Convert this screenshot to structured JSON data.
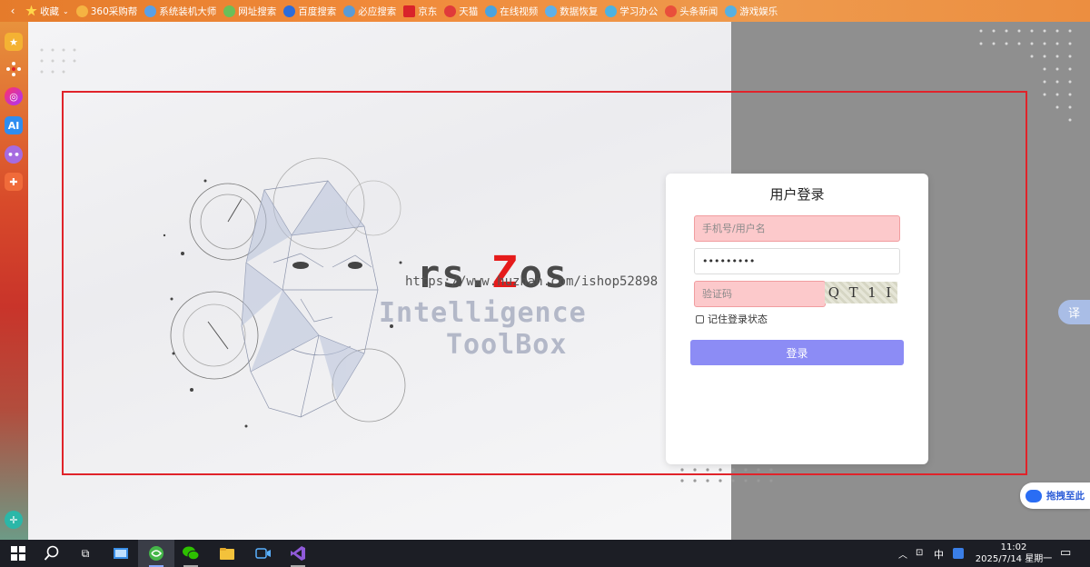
{
  "bookmarks": {
    "favorites": "收藏",
    "items": [
      "360采购帮",
      "系统装机大师",
      "网址搜索",
      "百度搜索",
      "必应搜索",
      "京东",
      "天猫",
      "在线视频",
      "数据恢复",
      "学习办公",
      "头条新闻",
      "游戏娱乐"
    ],
    "colors": [
      "#f5b342",
      "#5aa0e6",
      "#6bbf59",
      "#2c6cd8",
      "#5b9bd5",
      "#d9232a",
      "#e03a3a",
      "#4aa3df",
      "#5fb0e8",
      "#4db2e0",
      "#e94f3b",
      "#57b0e0"
    ]
  },
  "sidebar": {
    "icons": [
      "star-icon",
      "apps-icon",
      "ai-assistant-icon",
      "ai-icon",
      "chat-icon",
      "game-icon",
      "plus-circle-icon"
    ],
    "ai_label": "AI"
  },
  "hero": {
    "brand_pre": "rs.",
    "brand_z": "Z",
    "brand_post": "os",
    "watermark": "https://www.huzhan.com/ishop52898",
    "tagline_1": "Intelligence",
    "tagline_2": "ToolBox"
  },
  "login": {
    "title": "用户登录",
    "username_placeholder": "手机号/用户名",
    "password_value": "•••••••••",
    "captcha_placeholder": "验证码",
    "captcha_text": [
      "Q",
      "T",
      "1",
      "I"
    ],
    "remember_label": "记住登录状态",
    "submit_label": "登录",
    "button_color": "#8c8cf5"
  },
  "floating": {
    "translate_label": "译",
    "drag_label": "拖拽至此"
  },
  "taskbar": {
    "ime_label": "中",
    "time": "11:02",
    "date": "2025/7/14 星期一"
  }
}
